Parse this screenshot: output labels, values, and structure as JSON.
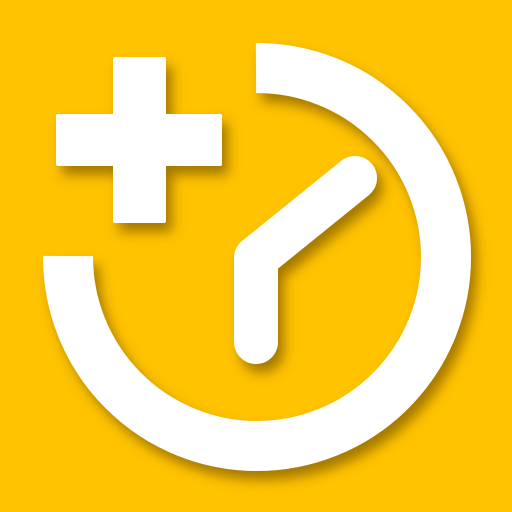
{
  "icon": {
    "name": "add-time-clock-icon",
    "background_color": "#FFC300",
    "foreground_color": "#FFFFFF",
    "shadow_color": "#5A3A00",
    "symbols": [
      "plus-icon",
      "clock-icon"
    ]
  }
}
